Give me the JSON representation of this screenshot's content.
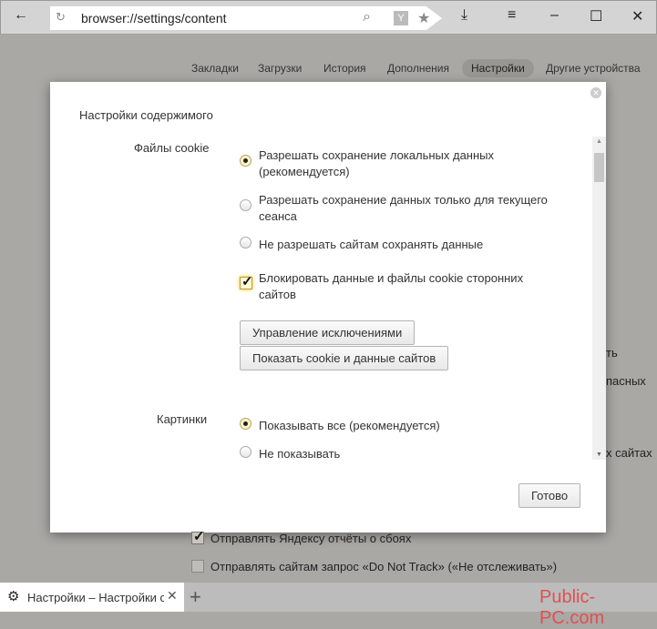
{
  "browser": {
    "url": "browser://settings/content",
    "tabs_nav": [
      "Закладки",
      "Загрузки",
      "История",
      "Дополнения",
      "Настройки",
      "Другие устройства"
    ],
    "active_nav": "Настройки"
  },
  "dialog": {
    "title": "Настройки содержимого",
    "cookies": {
      "label": "Файлы cookie",
      "options": [
        {
          "line1": "Разрешать сохранение локальных данных",
          "line2": "(рекомендуется)",
          "checked": true
        },
        {
          "line1": "Разрешать сохранение данных только для текущего",
          "line2": "сеанса",
          "checked": false
        },
        {
          "line1": "Не разрешать сайтам сохранять данные",
          "checked": false
        }
      ],
      "block_third_party": {
        "line1": "Блокировать данные и файлы cookie сторонних",
        "line2": "сайтов",
        "checked": true
      },
      "manage_exceptions": "Управление исключениями",
      "show_cookies": "Показать cookie и данные сайтов"
    },
    "images": {
      "label": "Картинки",
      "options": [
        {
          "label": "Показывать все (рекомендуется)",
          "checked": true
        },
        {
          "label": "Не показывать",
          "checked": false
        }
      ]
    },
    "done": "Готово"
  },
  "background": {
    "partial1": "ть",
    "partial2": "пасных",
    "partial3": "х сайтах",
    "send_reports": "Отправлять Яндексу отчёты о сбоях",
    "send_reports_checked": true,
    "dnt": "Отправлять сайтам запрос «Do Not Track» («Не отслеживать»)",
    "dnt_checked": false
  },
  "tab": {
    "title": "Настройки – Настройки с"
  },
  "watermark": "Public-PC.com"
}
